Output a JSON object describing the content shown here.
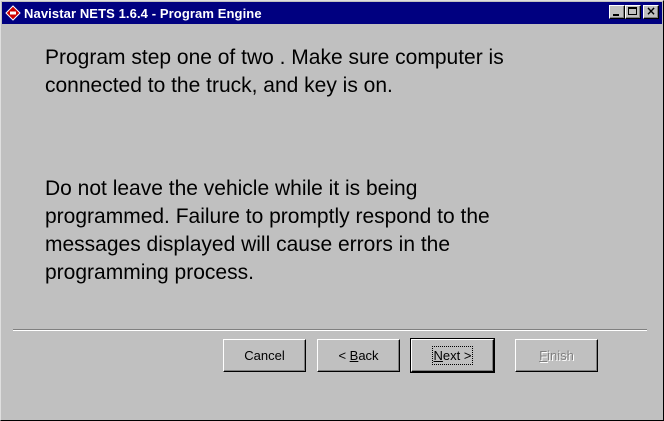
{
  "window": {
    "title": "Navistar NETS 1.6.4 - Program Engine",
    "icon": "navistar-diamond-icon",
    "controls": {
      "minimize": "minimize-icon",
      "maximize": "maximize-icon",
      "close": "close-icon"
    }
  },
  "content": {
    "message_1": "Program step one of two .  Make sure computer is\nconnected to the truck, and key is on.",
    "message_2": "Do not leave the vehicle while it is being\nprogrammed.  Failure to promptly respond to the\nmessages displayed will cause errors in the\nprogramming process."
  },
  "buttons": {
    "cancel": "Cancel",
    "back": {
      "prefix": "< ",
      "accel": "B",
      "rest": "ack"
    },
    "next": {
      "accel": "N",
      "rest": "ext >"
    },
    "finish": {
      "accel": "F",
      "rest": "inish"
    }
  },
  "colors": {
    "titlebar": "#000080",
    "face": "#c0c0c0",
    "icon_red": "#cc0000"
  }
}
